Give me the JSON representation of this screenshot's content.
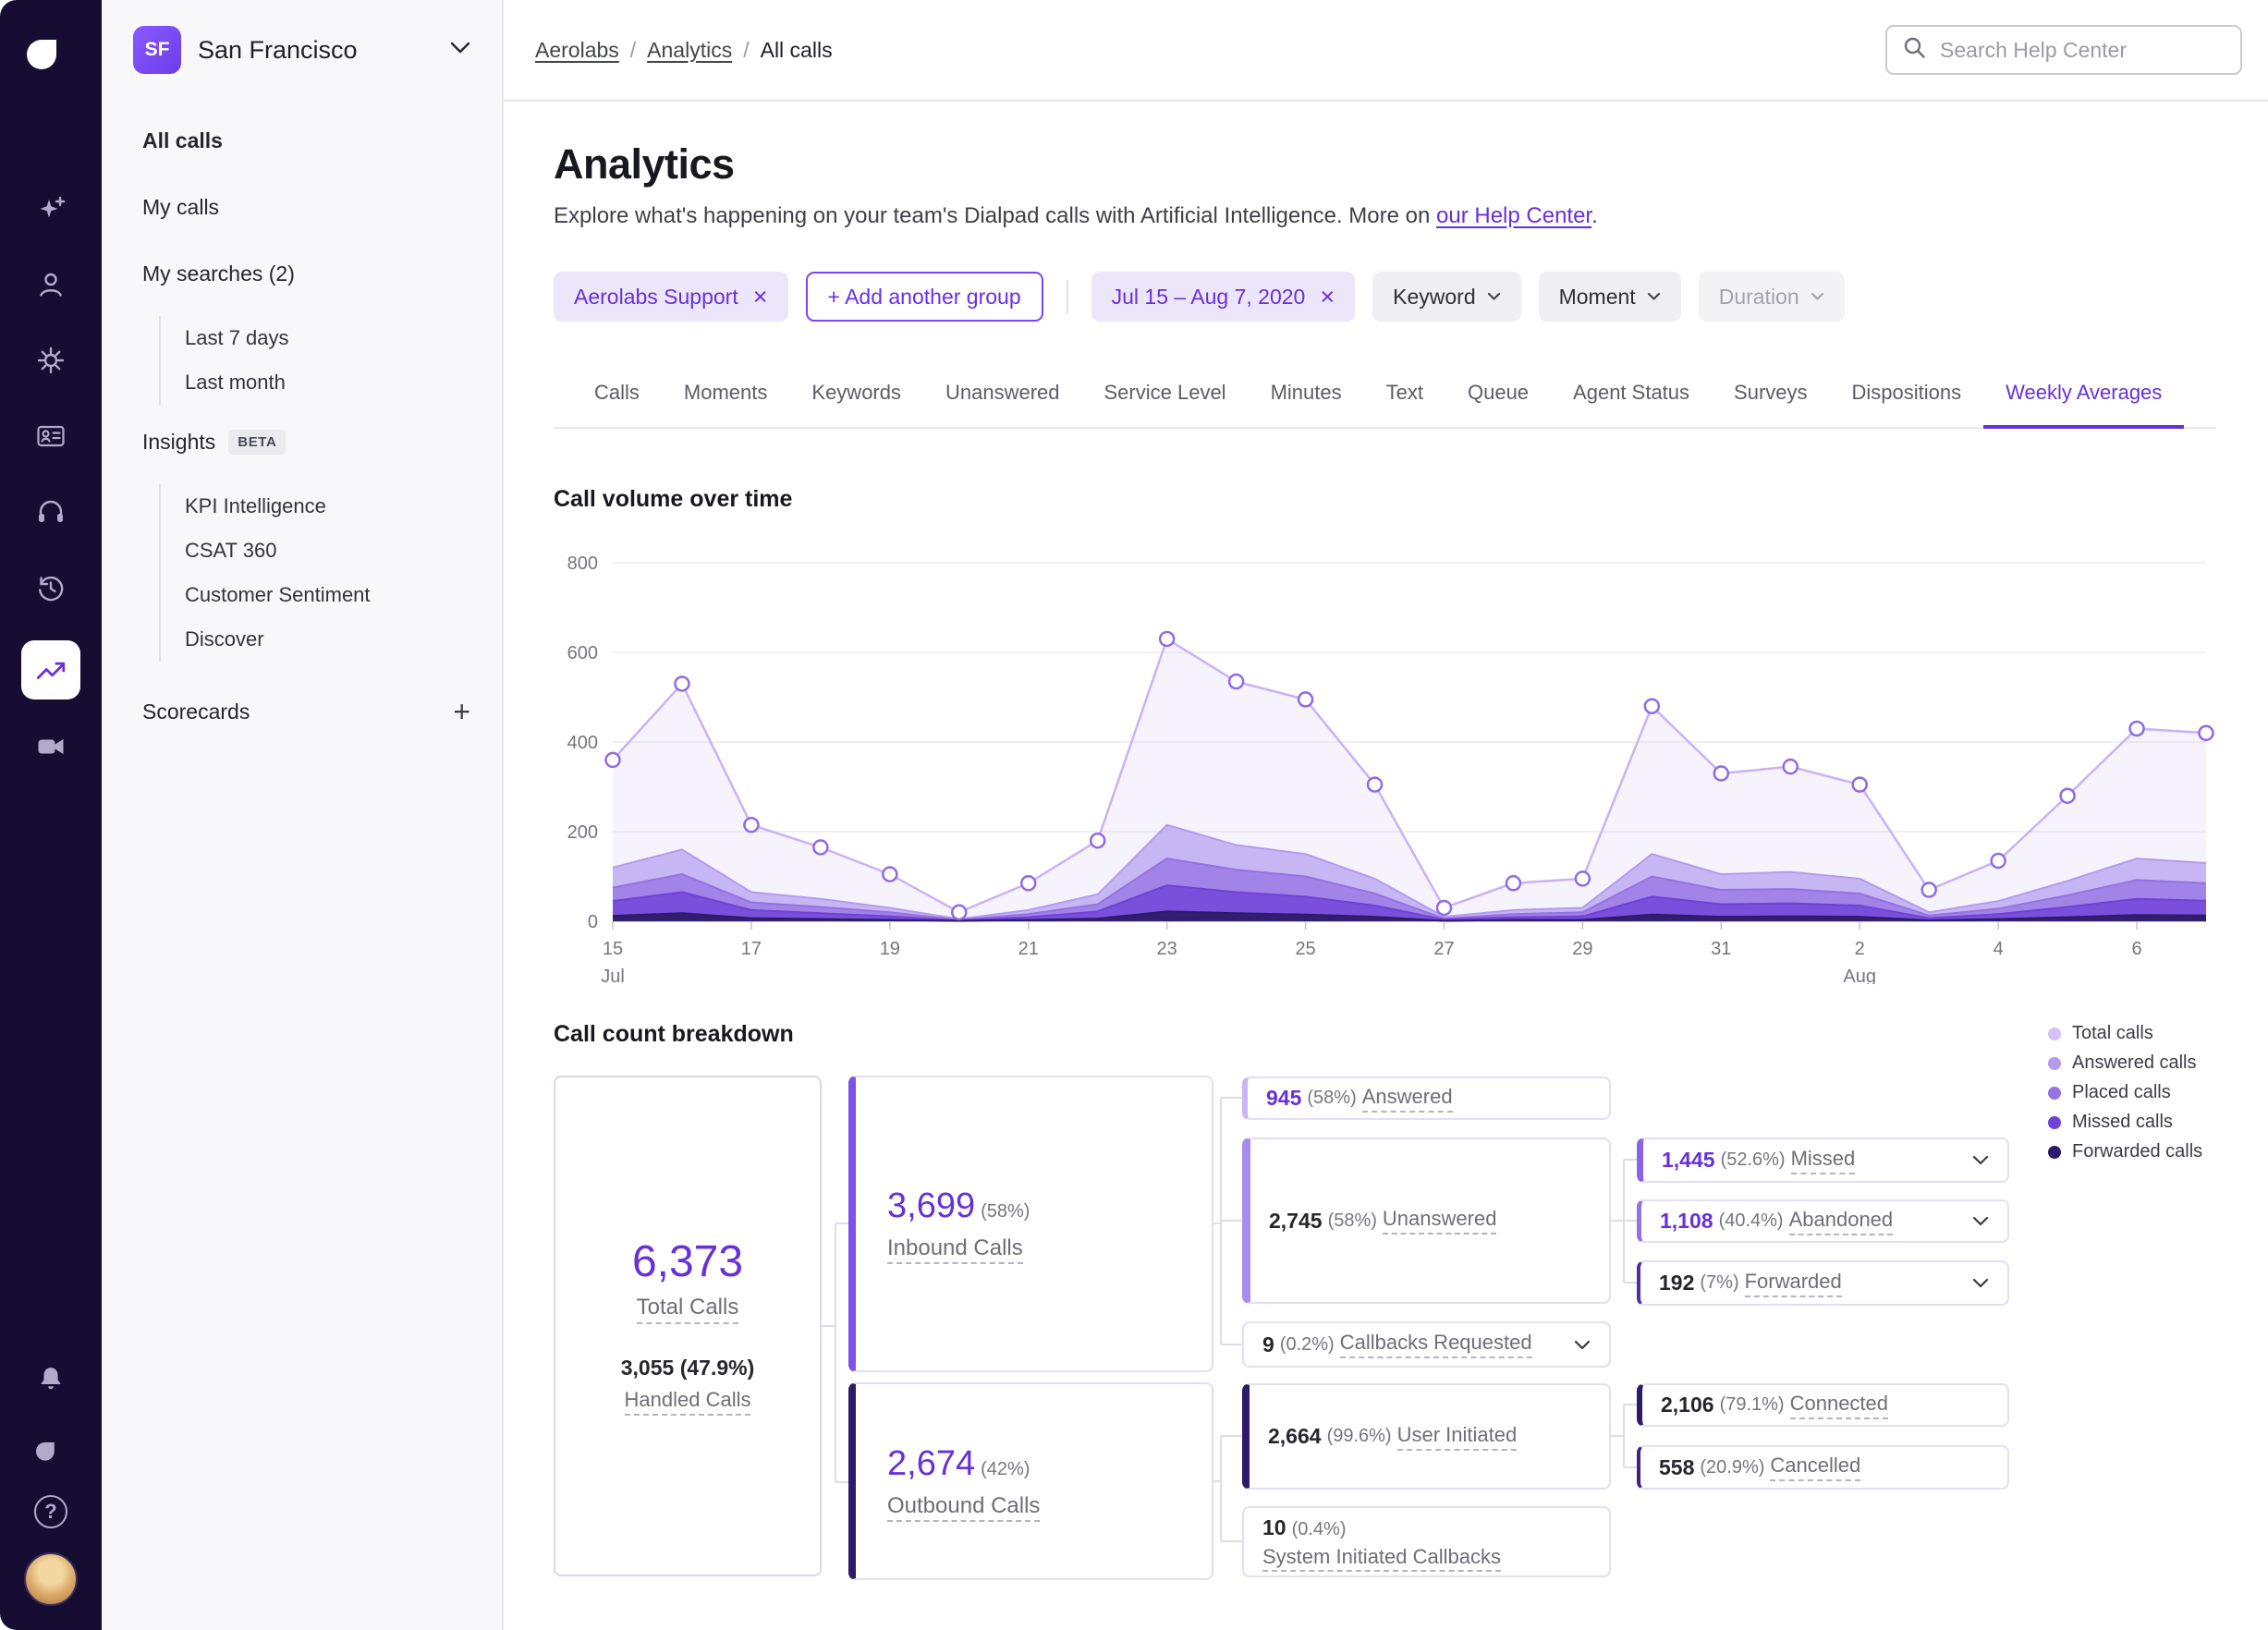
{
  "topbar": {
    "breadcrumb": [
      "Aerolabs",
      "Analytics",
      "All calls"
    ],
    "separator": "/",
    "search_placeholder": "Search Help Center"
  },
  "sidebar": {
    "team_initials": "SF",
    "team_name": "San Francisco",
    "all_calls": "All calls",
    "my_calls": "My calls",
    "my_searches": "My searches (2)",
    "searches": [
      "Last 7 days",
      "Last month"
    ],
    "insights": "Insights",
    "insights_badge": "BETA",
    "insights_items": [
      "KPI Intelligence",
      "CSAT 360",
      "Customer Sentiment",
      "Discover"
    ],
    "scorecards": "Scorecards"
  },
  "header": {
    "title": "Analytics",
    "subtitle_before": "Explore what's happening on your team's Dialpad calls with Artificial Intelligence. More on ",
    "subtitle_link": "our Help Center",
    "subtitle_after": "."
  },
  "filters": {
    "group_chip": "Aerolabs Support",
    "close_glyph": "×",
    "add_group": "+ Add another group",
    "date_chip": "Jul 15 – Aug 7, 2020",
    "keyword": "Keyword",
    "moment": "Moment",
    "duration": "Duration"
  },
  "tabs": [
    "Calls",
    "Moments",
    "Keywords",
    "Unanswered",
    "Service Level",
    "Minutes",
    "Text",
    "Queue",
    "Agent Status",
    "Surveys",
    "Dispositions",
    "Weekly Averages"
  ],
  "icon_glyphs": {
    "help": "?",
    "add": "+"
  },
  "chart_data": {
    "type": "line",
    "title": "Call volume over time",
    "xlabel": "",
    "ylabel": "",
    "ylim": [
      0,
      800
    ],
    "yticks": [
      0,
      200,
      400,
      600,
      800
    ],
    "grid": true,
    "legend_position": "right-of-breakdown",
    "marker_stroke": "#8F6AE8",
    "x": [
      "Jul 15",
      "Jul 16",
      "Jul 17",
      "Jul 18",
      "Jul 19",
      "Jul 20",
      "Jul 21",
      "Jul 22",
      "Jul 23",
      "Jul 24",
      "Jul 25",
      "Jul 26",
      "Jul 27",
      "Jul 28",
      "Jul 29",
      "Jul 30",
      "Jul 31",
      "Aug 1",
      "Aug 2",
      "Aug 3",
      "Aug 4",
      "Aug 5",
      "Aug 6",
      "Aug 7"
    ],
    "x_ticks": [
      {
        "i": 0,
        "label": "15",
        "month": "Jul"
      },
      {
        "i": 2,
        "label": "17"
      },
      {
        "i": 4,
        "label": "19"
      },
      {
        "i": 6,
        "label": "21"
      },
      {
        "i": 8,
        "label": "23"
      },
      {
        "i": 10,
        "label": "25"
      },
      {
        "i": 12,
        "label": "27"
      },
      {
        "i": 14,
        "label": "29"
      },
      {
        "i": 16,
        "label": "31"
      },
      {
        "i": 18,
        "label": "2",
        "month": "Aug"
      },
      {
        "i": 20,
        "label": "4"
      },
      {
        "i": 22,
        "label": "6"
      }
    ],
    "series": [
      {
        "name": "Total calls",
        "color": "#C9B2F5",
        "fill_opacity": 0.16,
        "values": [
          360,
          530,
          215,
          165,
          105,
          20,
          85,
          180,
          630,
          535,
          495,
          305,
          30,
          85,
          95,
          480,
          330,
          345,
          305,
          70,
          135,
          280,
          430,
          420
        ]
      },
      {
        "name": "Answered calls",
        "color": "#B49BEF",
        "fill_opacity": 0.7,
        "values": [
          120,
          160,
          65,
          50,
          30,
          5,
          25,
          60,
          215,
          170,
          150,
          95,
          10,
          25,
          30,
          150,
          105,
          110,
          95,
          20,
          45,
          90,
          140,
          130
        ]
      },
      {
        "name": "Placed calls",
        "color": "#9671E3",
        "fill_opacity": 0.75,
        "values": [
          75,
          105,
          42,
          32,
          20,
          3,
          16,
          38,
          140,
          115,
          100,
          62,
          6,
          16,
          20,
          100,
          70,
          72,
          62,
          13,
          28,
          58,
          92,
          85
        ]
      },
      {
        "name": "Missed calls",
        "color": "#6F42D8",
        "fill_opacity": 0.8,
        "values": [
          45,
          65,
          25,
          18,
          11,
          2,
          9,
          22,
          80,
          65,
          55,
          35,
          4,
          9,
          11,
          55,
          38,
          40,
          35,
          7,
          16,
          32,
          50,
          46
        ]
      },
      {
        "name": "Forwarded calls",
        "color": "#2D1B69",
        "fill_opacity": 0.95,
        "values": [
          12,
          18,
          7,
          5,
          3,
          1,
          3,
          6,
          22,
          18,
          15,
          10,
          1,
          3,
          3,
          15,
          10,
          11,
          10,
          2,
          5,
          9,
          14,
          13
        ]
      }
    ]
  },
  "legend": [
    {
      "label": "Total calls",
      "color": "#D4C2F7"
    },
    {
      "label": "Answered calls",
      "color": "#B49BEF"
    },
    {
      "label": "Placed calls",
      "color": "#9671E3"
    },
    {
      "label": "Missed calls",
      "color": "#6F42D8"
    },
    {
      "label": "Forwarded calls",
      "color": "#2D1B69"
    }
  ],
  "breakdown": {
    "title": "Call count breakdown",
    "total": {
      "value": "6,373",
      "label": "Total Calls",
      "sub_value": "3,055 (47.9%)",
      "sub_label": "Handled Calls"
    },
    "inbound": {
      "value": "3,699",
      "pct": "(58%)",
      "label": "Inbound Calls"
    },
    "outbound": {
      "value": "2,674",
      "pct": "(42%)",
      "label": "Outbound Calls"
    },
    "answered": {
      "value": "945",
      "pct": "(58%)",
      "label": "Answered"
    },
    "unanswered": {
      "value": "2,745",
      "pct": "(58%)",
      "label": "Unanswered"
    },
    "callbacks": {
      "value": "9",
      "pct": "(0.2%)",
      "label": "Callbacks Requested"
    },
    "user_initiated": {
      "value": "2,664",
      "pct": "(99.6%)",
      "label": "User Initiated"
    },
    "system_callbacks": {
      "value": "10",
      "pct": "(0.4%)",
      "label": "System Initiated Callbacks"
    },
    "missed": {
      "value": "1,445",
      "pct": "(52.6%)",
      "label": "Missed"
    },
    "abandoned": {
      "value": "1,108",
      "pct": "(40.4%)",
      "label": "Abandoned"
    },
    "forwarded": {
      "value": "192",
      "pct": "(7%)",
      "label": "Forwarded"
    },
    "connected": {
      "value": "2,106",
      "pct": "(79.1%)",
      "label": "Connected"
    },
    "cancelled": {
      "value": "558",
      "pct": "(20.9%)",
      "label": "Cancelled"
    }
  }
}
